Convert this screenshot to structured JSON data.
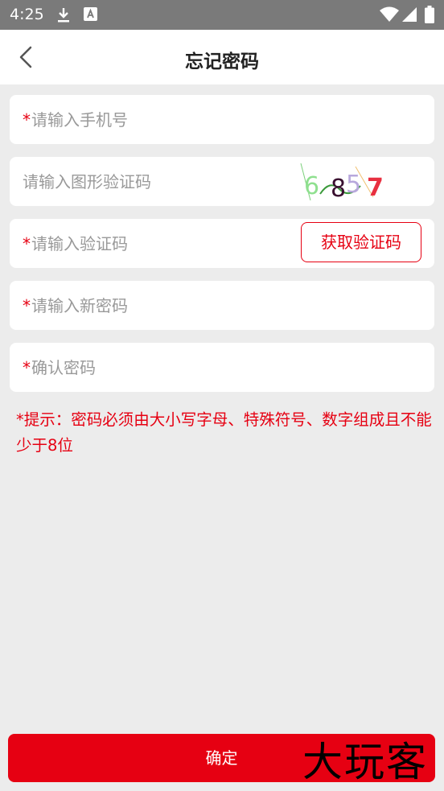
{
  "status_bar": {
    "time": "4:25",
    "icons": [
      "download-icon",
      "keyboard-a-icon",
      "wifi-icon",
      "signal-icon",
      "battery-icon"
    ]
  },
  "header": {
    "title": "忘记密码",
    "back_icon": "chevron-left-icon"
  },
  "form": {
    "phone": {
      "required_mark": "*",
      "placeholder": "请输入手机号"
    },
    "captcha": {
      "placeholder": "请输入图形验证码",
      "captcha_text": "6857"
    },
    "sms_code": {
      "required_mark": "*",
      "placeholder": "请输入验证码",
      "button_label": "获取验证码"
    },
    "new_password": {
      "required_mark": "*",
      "placeholder": "请输入新密码"
    },
    "confirm_password": {
      "required_mark": "*",
      "placeholder": "确认密码"
    }
  },
  "tip": "*提示：密码必须由大小写字母、特殊符号、数字组成且不能少于8位",
  "confirm_button": "确定",
  "watermark": "大玩客",
  "colors": {
    "accent": "#e60012",
    "background": "#ececec",
    "status_bar": "#7a7a7a"
  }
}
